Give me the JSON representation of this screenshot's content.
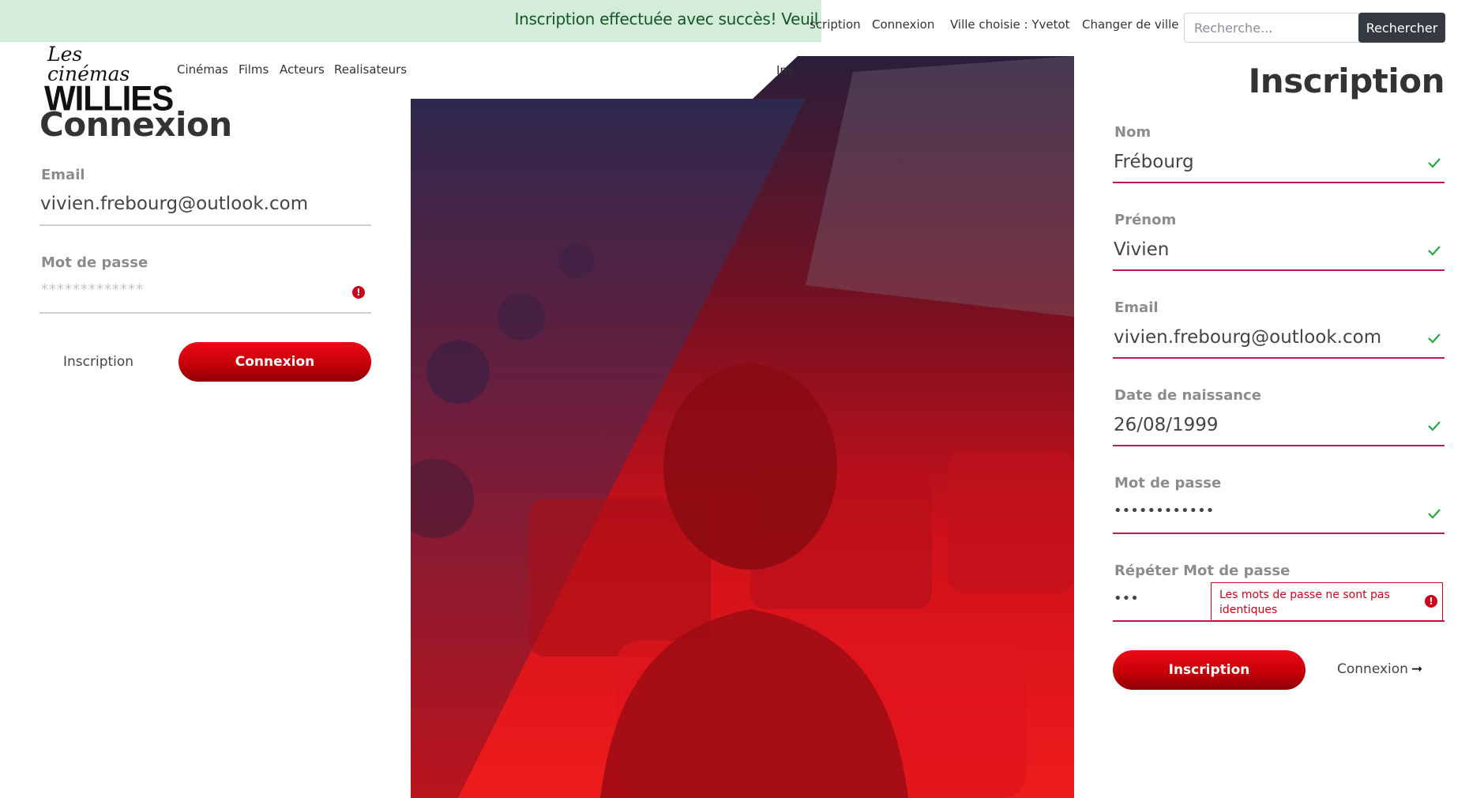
{
  "banner": {
    "message": "Inscription effectuée avec succès! Veuil"
  },
  "topnav": {
    "inscription_partial": "scription",
    "connexion": "Connexion",
    "ville": "Ville choisie : Yvetot",
    "changer_ville": "Changer de ville",
    "search_placeholder": "Recherche...",
    "search_button": "Rechercher"
  },
  "logo": {
    "script": "Les cinémas",
    "main": "WILLIES"
  },
  "mainnav": {
    "items": [
      "Cinémas",
      "Films",
      "Acteurs",
      "Realisateurs"
    ],
    "ins_partial": "Ins"
  },
  "connexion": {
    "title": "Connexion",
    "email_label": "Email",
    "email_value": "vivien.frebourg@outlook.com",
    "password_label": "Mot de passe",
    "password_placeholder": "*************",
    "inscription_link": "Inscription",
    "submit": "Connexion"
  },
  "inscription": {
    "title": "Inscription",
    "fields": [
      {
        "label": "Nom",
        "value": "Frébourg"
      },
      {
        "label": "Prénom",
        "value": "Vivien"
      },
      {
        "label": "Email",
        "value": "vivien.frebourg@outlook.com"
      },
      {
        "label": "Date de naissance",
        "value": "26/08/1999"
      },
      {
        "label": "Mot de passe",
        "value": "••••••••••••"
      },
      {
        "label": "Répéter Mot de passe",
        "value": "•••"
      }
    ],
    "error_message": "Les mots de passe ne sont pas identiques",
    "submit": "Inscription",
    "connexion_link": "Connexion",
    "connexion_arrow": "➞"
  },
  "colors": {
    "accent_red": "#d0021b",
    "valid_green": "#28a745",
    "field_line_pink": "#c2185b",
    "banner_bg": "#d4eddb",
    "banner_text": "#155724"
  },
  "icons": {
    "error": "exclamation-circle-icon",
    "valid": "check-icon",
    "arrow": "arrow-right-icon"
  }
}
